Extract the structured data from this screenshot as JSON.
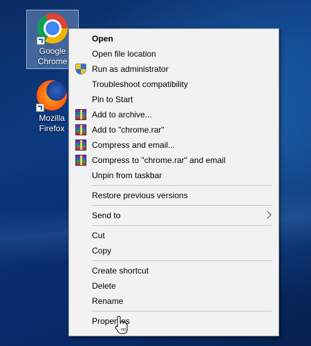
{
  "desktop": {
    "icons": [
      {
        "label_line1": "Google",
        "label_line2": "Chrome",
        "icon": "chrome-icon",
        "selected": true
      },
      {
        "label_line1": "Mozilla",
        "label_line2": "Firefox",
        "icon": "firefox-icon",
        "selected": false
      }
    ]
  },
  "context_menu": {
    "items": [
      {
        "label": "Open",
        "bold": true,
        "icon": null
      },
      {
        "label": "Open file location",
        "icon": null
      },
      {
        "label": "Run as administrator",
        "icon": "uac-shield-icon"
      },
      {
        "label": "Troubleshoot compatibility",
        "icon": null
      },
      {
        "label": "Pin to Start",
        "icon": null
      },
      {
        "label": "Add to archive...",
        "icon": "winrar-icon"
      },
      {
        "label": "Add to \"chrome.rar\"",
        "icon": "winrar-icon"
      },
      {
        "label": "Compress and email...",
        "icon": "winrar-icon"
      },
      {
        "label": "Compress to \"chrome.rar\" and email",
        "icon": "winrar-icon"
      },
      {
        "label": "Unpin from taskbar",
        "icon": null
      },
      {
        "label": "Restore previous versions",
        "icon": null
      },
      {
        "label": "Send to",
        "icon": null,
        "submenu": true
      },
      {
        "label": "Cut",
        "icon": null
      },
      {
        "label": "Copy",
        "icon": null
      },
      {
        "label": "Create shortcut",
        "icon": null
      },
      {
        "label": "Delete",
        "icon": null
      },
      {
        "label": "Rename",
        "icon": null
      },
      {
        "label": "Properties",
        "icon": null,
        "hovered": true
      }
    ]
  },
  "cursor": {
    "icon": "hand-pointer-icon"
  }
}
